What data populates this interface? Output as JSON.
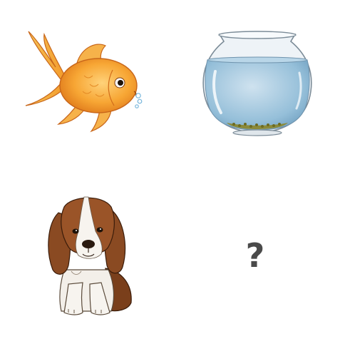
{
  "puzzle": {
    "question_symbol": "?",
    "items": [
      {
        "icon": "goldfish-icon"
      },
      {
        "icon": "fishbowl-icon"
      },
      {
        "icon": "dog-icon"
      }
    ]
  },
  "colors": {
    "fish_body": "#f5a623",
    "fish_outline": "#c8661a",
    "bowl_water": "#9cc3dd",
    "bowl_glass": "#e6eef4",
    "dog_brown": "#8a4a22",
    "dog_white": "#f4f1ec",
    "question": "#4a4a4a"
  }
}
